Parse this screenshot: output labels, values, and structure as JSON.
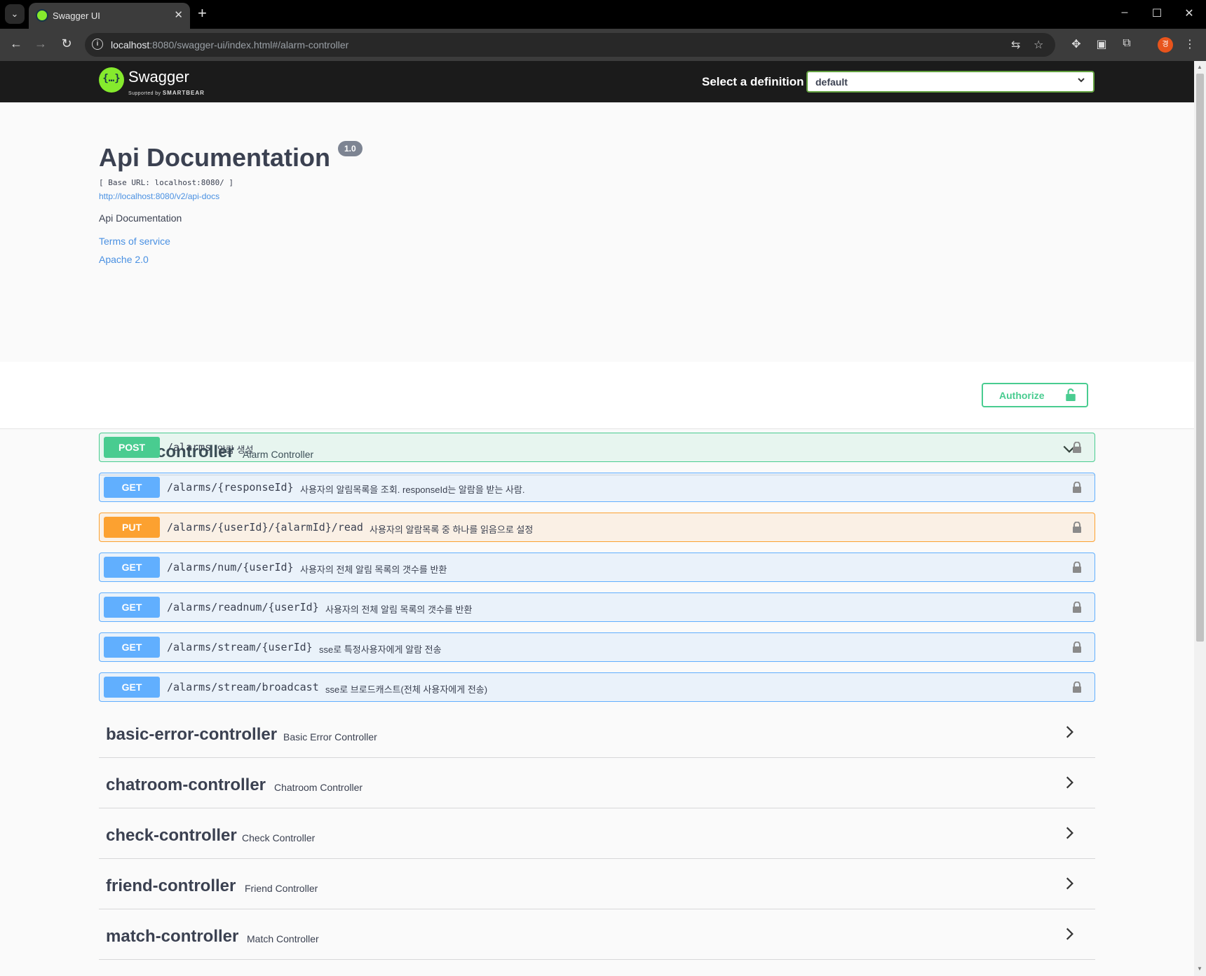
{
  "browser": {
    "tab_title": "Swagger UI",
    "url_host": "localhost",
    "url_rest": ":8080/swagger-ui/index.html#/alarm-controller",
    "profile_initial": "경"
  },
  "topbar": {
    "brand": "Swagger",
    "sub_prefix": "Supported by",
    "sub_company": "SMARTBEAR",
    "definition_label": "Select a definition",
    "definition_value": "default"
  },
  "info": {
    "title": "Api Documentation",
    "version": "1.0",
    "base_url": "[ Base URL: localhost:8080/ ]",
    "docs_link": "http://localhost:8080/v2/api-docs",
    "description": "Api Documentation",
    "terms": "Terms of service",
    "license": "Apache 2.0"
  },
  "authorize": {
    "label": "Authorize"
  },
  "alarm_controller": {
    "name": "alarm-controller",
    "description": "Alarm Controller",
    "operations": [
      {
        "method": "POST",
        "path": "/alarms",
        "summary": "알람 생성"
      },
      {
        "method": "GET",
        "path": "/alarms/{responseId}",
        "summary": "사용자의 알림목록을 조회. responseId는 알람을 받는 사람."
      },
      {
        "method": "PUT",
        "path": "/alarms/{userId}/{alarmId}/read",
        "summary": "사용자의 알람목록 중 하나를 읽음으로 설정"
      },
      {
        "method": "GET",
        "path": "/alarms/num/{userId}",
        "summary": "사용자의 전체 알림 목록의 갯수를 반환"
      },
      {
        "method": "GET",
        "path": "/alarms/readnum/{userId}",
        "summary": "사용자의 전체 알림 목록의 갯수를 반환"
      },
      {
        "method": "GET",
        "path": "/alarms/stream/{userId}",
        "summary": "sse로 특정사용자에게 알람 전송"
      },
      {
        "method": "GET",
        "path": "/alarms/stream/broadcast",
        "summary": "sse로 브로드캐스트(전체 사용자에게 전송)"
      }
    ]
  },
  "controllers": [
    {
      "name": "basic-error-controller",
      "description": "Basic Error Controller"
    },
    {
      "name": "chatroom-controller",
      "description": "Chatroom Controller"
    },
    {
      "name": "check-controller",
      "description": "Check Controller"
    },
    {
      "name": "friend-controller",
      "description": "Friend Controller"
    },
    {
      "name": "match-controller",
      "description": "Match Controller"
    }
  ],
  "colors": {
    "post": "#49cc90",
    "get": "#61affe",
    "put": "#fca130",
    "swagger_green": "#85ea2d",
    "link": "#4990e2",
    "text": "#3b4151"
  }
}
